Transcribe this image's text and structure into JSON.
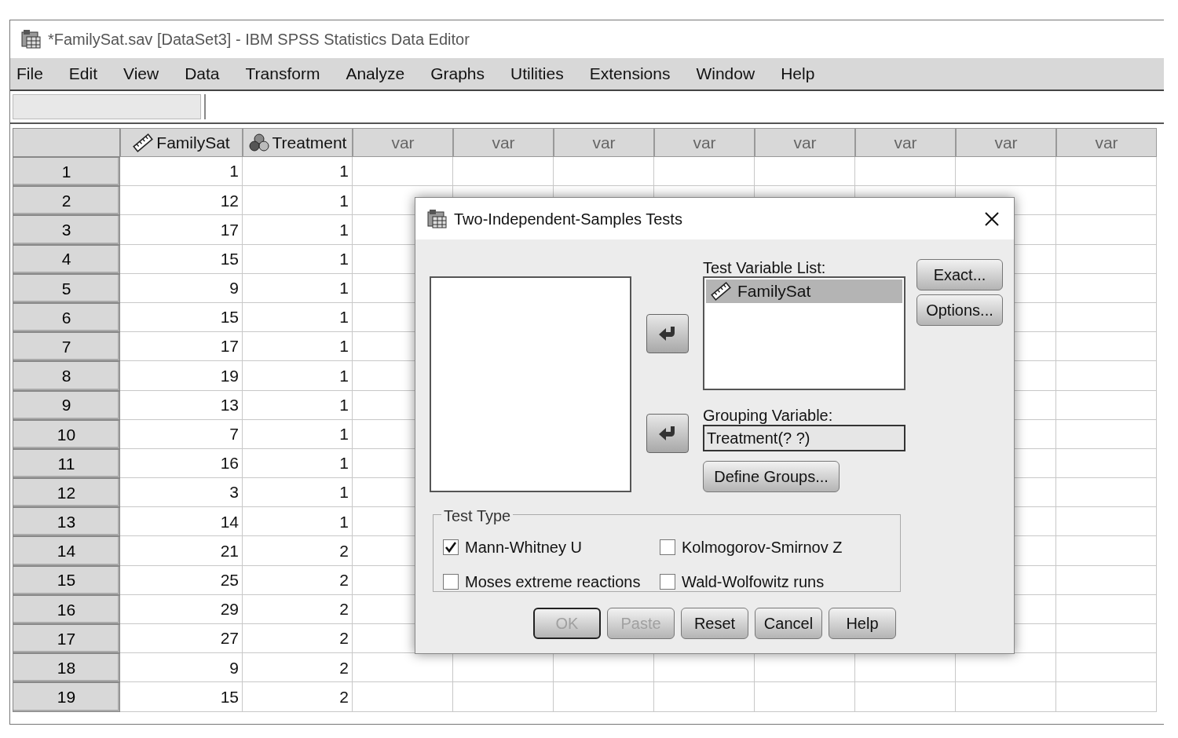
{
  "window": {
    "title": "*FamilySat.sav [DataSet3] - IBM SPSS Statistics Data Editor"
  },
  "menu": [
    "File",
    "Edit",
    "View",
    "Data",
    "Transform",
    "Analyze",
    "Graphs",
    "Utilities",
    "Extensions",
    "Window",
    "Help"
  ],
  "grid": {
    "columns": [
      {
        "label": "FamilySat",
        "kind": "scale"
      },
      {
        "label": "Treatment",
        "kind": "nominal"
      },
      {
        "label": "var",
        "kind": "empty"
      },
      {
        "label": "var",
        "kind": "empty"
      },
      {
        "label": "var",
        "kind": "empty"
      },
      {
        "label": "var",
        "kind": "empty"
      },
      {
        "label": "var",
        "kind": "empty"
      },
      {
        "label": "var",
        "kind": "empty"
      },
      {
        "label": "var",
        "kind": "empty"
      },
      {
        "label": "var",
        "kind": "empty"
      }
    ],
    "rows": [
      {
        "number": "1",
        "values": [
          "1",
          "1"
        ]
      },
      {
        "number": "2",
        "values": [
          "12",
          "1"
        ]
      },
      {
        "number": "3",
        "values": [
          "17",
          "1"
        ]
      },
      {
        "number": "4",
        "values": [
          "15",
          "1"
        ]
      },
      {
        "number": "5",
        "values": [
          "9",
          "1"
        ]
      },
      {
        "number": "6",
        "values": [
          "15",
          "1"
        ]
      },
      {
        "number": "7",
        "values": [
          "17",
          "1"
        ]
      },
      {
        "number": "8",
        "values": [
          "19",
          "1"
        ]
      },
      {
        "number": "9",
        "values": [
          "13",
          "1"
        ]
      },
      {
        "number": "10",
        "values": [
          "7",
          "1"
        ]
      },
      {
        "number": "11",
        "values": [
          "16",
          "1"
        ]
      },
      {
        "number": "12",
        "values": [
          "3",
          "1"
        ]
      },
      {
        "number": "13",
        "values": [
          "14",
          "1"
        ]
      },
      {
        "number": "14",
        "values": [
          "21",
          "2"
        ]
      },
      {
        "number": "15",
        "values": [
          "25",
          "2"
        ]
      },
      {
        "number": "16",
        "values": [
          "29",
          "2"
        ]
      },
      {
        "number": "17",
        "values": [
          "27",
          "2"
        ]
      },
      {
        "number": "18",
        "values": [
          "9",
          "2"
        ]
      },
      {
        "number": "19",
        "values": [
          "15",
          "2"
        ]
      }
    ]
  },
  "dialog": {
    "title": "Two-Independent-Samples Tests",
    "test_variable_list": {
      "label": "Test Variable List:",
      "items": [
        {
          "name": "FamilySat",
          "kind": "scale",
          "selected": true
        }
      ]
    },
    "side_buttons": [
      "Exact...",
      "Options..."
    ],
    "grouping_variable": {
      "label": "Grouping Variable:",
      "value": "Treatment(? ?)"
    },
    "define_groups_button": "Define Groups...",
    "test_type": {
      "title": "Test Type",
      "options": [
        {
          "label": "Mann-Whitney U",
          "checked": true
        },
        {
          "label": "Kolmogorov-Smirnov Z",
          "checked": false
        },
        {
          "label": "Moses extreme reactions",
          "checked": false
        },
        {
          "label": "Wald-Wolfowitz runs",
          "checked": false
        }
      ]
    },
    "buttons": [
      {
        "label": "OK",
        "disabled": true,
        "default": true
      },
      {
        "label": "Paste",
        "disabled": true,
        "default": false
      },
      {
        "label": "Reset",
        "disabled": false,
        "default": false
      },
      {
        "label": "Cancel",
        "disabled": false,
        "default": false
      },
      {
        "label": "Help",
        "disabled": false,
        "default": false
      }
    ]
  }
}
